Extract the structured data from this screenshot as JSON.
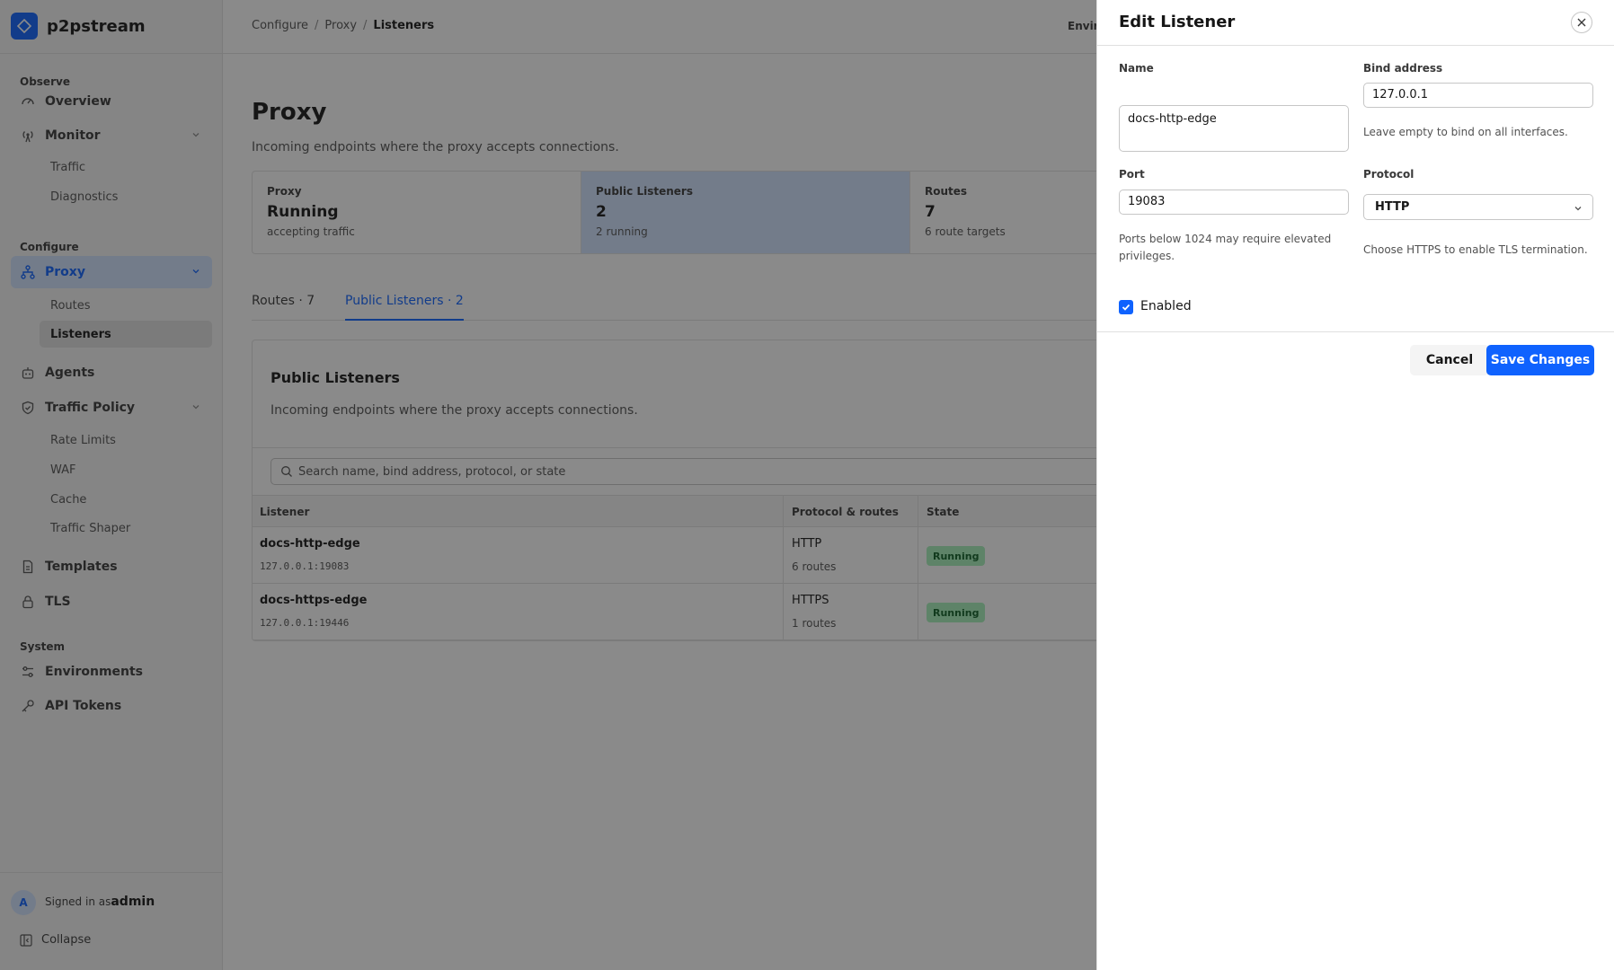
{
  "app": {
    "name": "p2pstream"
  },
  "sidebar": {
    "sections": {
      "observe": "Observe",
      "configure": "Configure",
      "system": "System"
    },
    "items": {
      "overview": "Overview",
      "monitor": "Monitor",
      "traffic": "Traffic",
      "diagnostics": "Diagnostics",
      "proxy": "Proxy",
      "routes": "Routes",
      "listeners": "Listeners",
      "agents": "Agents",
      "traffic_policy": "Traffic Policy",
      "rate_limits": "Rate Limits",
      "waf": "WAF",
      "cache": "Cache",
      "traffic_shaper": "Traffic Shaper",
      "templates": "Templates",
      "tls": "TLS",
      "environments": "Environments",
      "api_tokens": "API Tokens"
    },
    "user": {
      "initial": "A",
      "signed_in_as": "Signed in as",
      "name": "admin"
    },
    "collapse": "Collapse"
  },
  "topbar": {
    "breadcrumb": [
      "Configure",
      "Proxy",
      "Listeners"
    ],
    "env_label": "Envir"
  },
  "page": {
    "title": "Proxy",
    "description": "Incoming endpoints where the proxy accepts connections."
  },
  "stats": [
    {
      "label": "Proxy",
      "value": "Running",
      "sub": "accepting traffic"
    },
    {
      "label": "Public Listeners",
      "value": "2",
      "sub": "2 running"
    },
    {
      "label": "Routes",
      "value": "7",
      "sub": "6 route targets"
    }
  ],
  "tabs": [
    {
      "label": "Routes · 7"
    },
    {
      "label": "Public Listeners · 2"
    }
  ],
  "card": {
    "title": "Public Listeners",
    "description": "Incoming endpoints where the proxy accepts connections.",
    "search_placeholder": "Search name, bind address, protocol, or state",
    "columns": [
      "Listener",
      "Protocol & routes",
      "State"
    ],
    "rows": [
      {
        "name": "docs-http-edge",
        "address": "127.0.0.1:19083",
        "protocol": "HTTP",
        "routes": "6 routes",
        "state": "Running"
      },
      {
        "name": "docs-https-edge",
        "address": "127.0.0.1:19446",
        "protocol": "HTTPS",
        "routes": "1 routes",
        "state": "Running"
      }
    ]
  },
  "drawer": {
    "title": "Edit Listener",
    "name_label": "Name",
    "name_value": "docs-http-edge",
    "bind_label": "Bind address",
    "bind_value": "127.0.0.1",
    "bind_help": "Leave empty to bind on all interfaces.",
    "port_label": "Port",
    "port_value": "19083",
    "port_help": "Ports below 1024 may require elevated privileges.",
    "protocol_label": "Protocol",
    "protocol_value": "HTTP",
    "protocol_help": "Choose HTTPS to enable TLS termination.",
    "enabled_label": "Enabled",
    "cancel_label": "Cancel",
    "save_label": "Save Changes"
  },
  "colors": {
    "accent": "#0f62fe",
    "success_bg": "#a7f0ba",
    "success_fg": "#0e6027"
  }
}
